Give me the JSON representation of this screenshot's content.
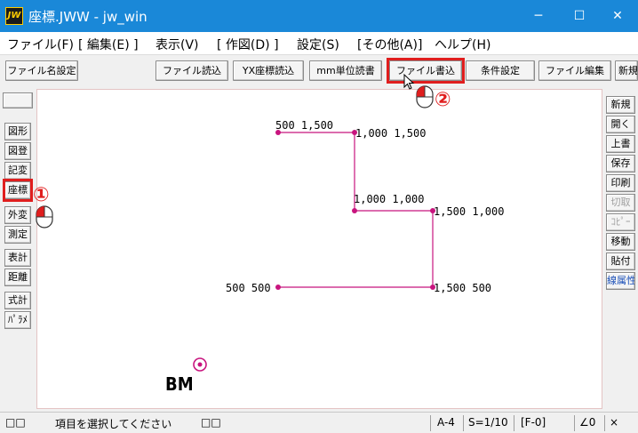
{
  "window": {
    "app_icon_text": "JW",
    "title": "座標.JWW - jw_win",
    "minimize_glyph": "─",
    "maximize_glyph": "☐",
    "close_glyph": "✕"
  },
  "menu": [
    "ファイル(F)",
    "[ 編集(E) ]",
    "表示(V)",
    "[ 作図(D) ]",
    "設定(S)",
    "[その他(A)]",
    "ヘルプ(H)"
  ],
  "toolbar": [
    "ファイル名設定",
    "ファイル読込",
    "YX座標読込",
    "mm単位読書",
    "ファイル書込",
    "条件設定",
    "ファイル編集",
    "新規"
  ],
  "left_tools": [
    "図形",
    "図登",
    "記変",
    "座標",
    "外変",
    "測定",
    "表計",
    "距離",
    "式計",
    "ﾊﾟﾗﾒ"
  ],
  "right_tools": [
    "新規",
    "開く",
    "上書",
    "保存",
    "印刷",
    "切取",
    "ｺﾋﾟｰ",
    "移動",
    "貼付",
    "線属性"
  ],
  "callouts": {
    "step1": "①",
    "step2": "②"
  },
  "drawing": {
    "labels": [
      "500 1,500",
      "1,000 1,500",
      "1,000 1,000",
      "1,500 1,000",
      "500 500",
      "1,500 500"
    ],
    "bm_label": "BM",
    "line_color": "#c8147e"
  },
  "status": {
    "left_boxes": "□□",
    "message": "項目を選択してください",
    "mid_boxes": "□□",
    "paper": "A-4",
    "scale": "S=1/10",
    "layer": "[F-0]",
    "angle": "∠0",
    "end_glyph": "×"
  }
}
